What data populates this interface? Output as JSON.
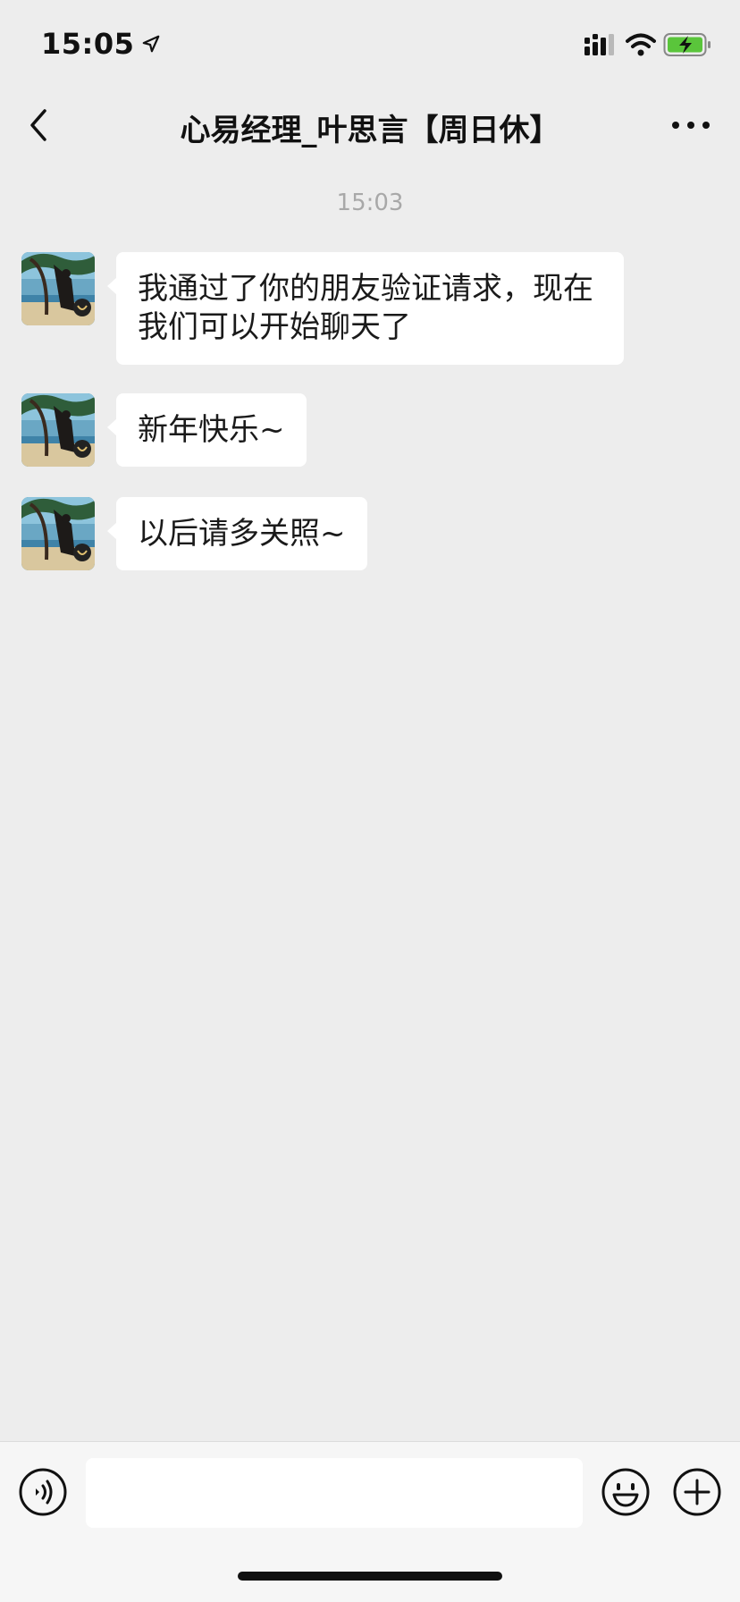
{
  "status_bar": {
    "time": "15:05",
    "icons": [
      "location-arrow-icon",
      "cellular-signal-icon",
      "wifi-icon",
      "battery-charging-icon"
    ],
    "battery_color": "#5ac53b"
  },
  "nav": {
    "title": "心易经理_叶思言【周日休】",
    "icons": [
      "back-chevron-icon",
      "more-dots-icon"
    ]
  },
  "chat": {
    "timestamp": "15:03",
    "messages": [
      {
        "sender": "contact",
        "text": "我通过了你的朋友验证请求，现在我们可以开始聊天了"
      },
      {
        "sender": "contact",
        "text": "新年快乐~"
      },
      {
        "sender": "contact",
        "text": "以后请多关照~"
      }
    ]
  },
  "input_bar": {
    "input_value": "",
    "icons": [
      "voice-icon",
      "emoji-icon",
      "plus-icon"
    ]
  },
  "colors": {
    "background": "#ededed",
    "bubble": "#ffffff",
    "timestamp": "#a8a8a8"
  }
}
